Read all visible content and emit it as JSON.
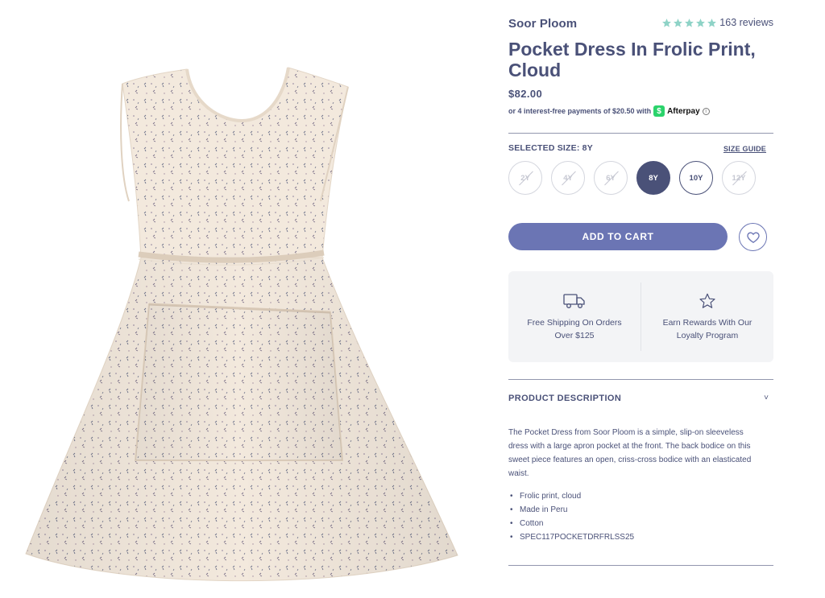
{
  "product": {
    "brand": "Soor Ploom",
    "title": "Pocket Dress In Frolic Print, Cloud",
    "price": "$82.00",
    "rating": {
      "stars": 5,
      "reviews_label": "163 reviews",
      "star_color": "#8fd3c7"
    },
    "afterpay": {
      "text": "or 4 interest-free payments of $20.50 with",
      "badge": "$",
      "brand": "Afterpay",
      "info_glyph": "i"
    },
    "image_icon": "dress-photo"
  },
  "size": {
    "selected_label": "SELECTED SIZE: 8Y",
    "guide_label": "SIZE GUIDE",
    "options": [
      {
        "label": "2Y",
        "state": "disabled"
      },
      {
        "label": "4Y",
        "state": "disabled"
      },
      {
        "label": "6Y",
        "state": "disabled"
      },
      {
        "label": "8Y",
        "state": "selected"
      },
      {
        "label": "10Y",
        "state": "available"
      },
      {
        "label": "12Y",
        "state": "disabled"
      }
    ]
  },
  "actions": {
    "add_to_cart": "ADD TO CART",
    "wishlist_icon": "heart-icon"
  },
  "perks": [
    {
      "icon": "truck-icon",
      "text": "Free Shipping On Orders Over $125"
    },
    {
      "icon": "star-icon",
      "text": "Earn Rewards With Our Loyalty Program"
    }
  ],
  "description": {
    "title": "PRODUCT DESCRIPTION",
    "chevron": "˅",
    "body": "The Pocket Dress from Soor Ploom is a simple, slip-on sleeveless dress with a large apron pocket at the front. The back bodice on this sweet piece features an open, criss-cross bodice with an elasticated waist.",
    "bullets": [
      "Frolic print, cloud",
      "Made in Peru",
      "Cotton",
      "SPEC117POCKETDRFRLSS25"
    ]
  },
  "colors": {
    "text": "#4a5178",
    "button": "#6b75b4",
    "afterpay": "#2bd36b",
    "fabric": "#f2e8dc"
  }
}
